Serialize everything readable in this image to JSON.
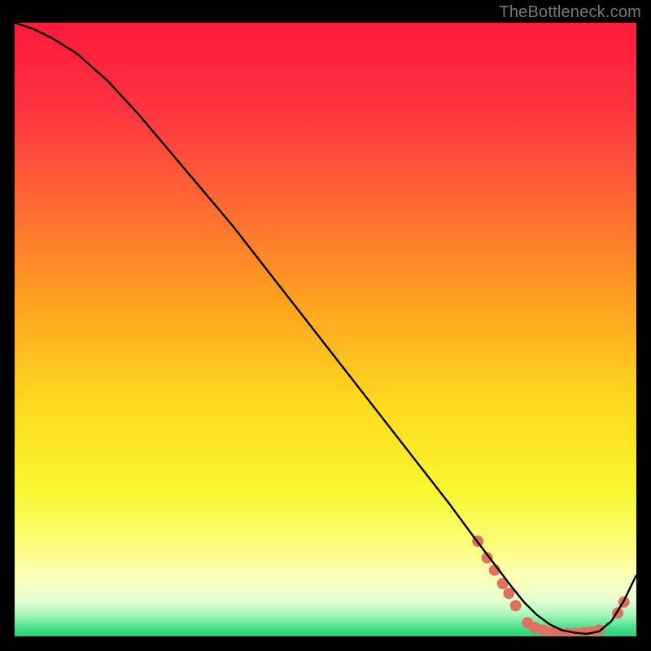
{
  "watermark": "TheBottleneck.com",
  "chart_data": {
    "type": "line",
    "title": "",
    "xlabel": "",
    "ylabel": "",
    "xlim": [
      0,
      100
    ],
    "ylim": [
      0,
      100
    ],
    "grid": false,
    "background_gradient": {
      "stops": [
        {
          "offset": 0.0,
          "color": "#ff1a3d"
        },
        {
          "offset": 0.14,
          "color": "#ff3340"
        },
        {
          "offset": 0.3,
          "color": "#ff6a33"
        },
        {
          "offset": 0.46,
          "color": "#ffa31f"
        },
        {
          "offset": 0.62,
          "color": "#ffd91f"
        },
        {
          "offset": 0.76,
          "color": "#f8f62e"
        },
        {
          "offset": 0.85,
          "color": "#fbfe7a"
        },
        {
          "offset": 0.9,
          "color": "#fdffb4"
        },
        {
          "offset": 0.94,
          "color": "#e8ffd2"
        },
        {
          "offset": 0.965,
          "color": "#a8f6b8"
        },
        {
          "offset": 0.985,
          "color": "#4fe08e"
        },
        {
          "offset": 1.0,
          "color": "#29d07a"
        }
      ]
    },
    "series": [
      {
        "name": "bottleneck-curve",
        "stroke": "#000000",
        "x": [
          0,
          3,
          6,
          10,
          15,
          20,
          25,
          30,
          35,
          40,
          45,
          50,
          55,
          60,
          65,
          70,
          74,
          77,
          80,
          82,
          84,
          86,
          88,
          90,
          92,
          94,
          96,
          98,
          100
        ],
        "y": [
          100,
          99,
          97.5,
          95,
          90.5,
          85,
          79,
          73,
          67,
          60.5,
          54,
          47.5,
          41,
          34.5,
          28,
          21.5,
          16,
          12,
          8,
          5.5,
          3.5,
          2,
          1,
          0.6,
          0.4,
          0.8,
          2.5,
          5.8,
          10
        ]
      }
    ],
    "markers": {
      "name": "highlight-dots",
      "color": "#e07060",
      "radius": 7,
      "points": [
        {
          "x": 74.5,
          "y": 15.5
        },
        {
          "x": 76.0,
          "y": 12.8
        },
        {
          "x": 77.2,
          "y": 10.8
        },
        {
          "x": 78.5,
          "y": 8.6
        },
        {
          "x": 79.5,
          "y": 7.0
        },
        {
          "x": 80.6,
          "y": 5.0
        },
        {
          "x": 82.5,
          "y": 2.2
        },
        {
          "x": 83.7,
          "y": 1.4
        },
        {
          "x": 85.0,
          "y": 1.0
        },
        {
          "x": 86.3,
          "y": 0.7
        },
        {
          "x": 87.6,
          "y": 0.5
        },
        {
          "x": 88.9,
          "y": 0.5
        },
        {
          "x": 90.2,
          "y": 0.5
        },
        {
          "x": 91.5,
          "y": 0.6
        },
        {
          "x": 92.7,
          "y": 0.7
        },
        {
          "x": 94.0,
          "y": 1.0
        },
        {
          "x": 97.0,
          "y": 3.8
        },
        {
          "x": 98.0,
          "y": 5.6
        }
      ]
    }
  }
}
